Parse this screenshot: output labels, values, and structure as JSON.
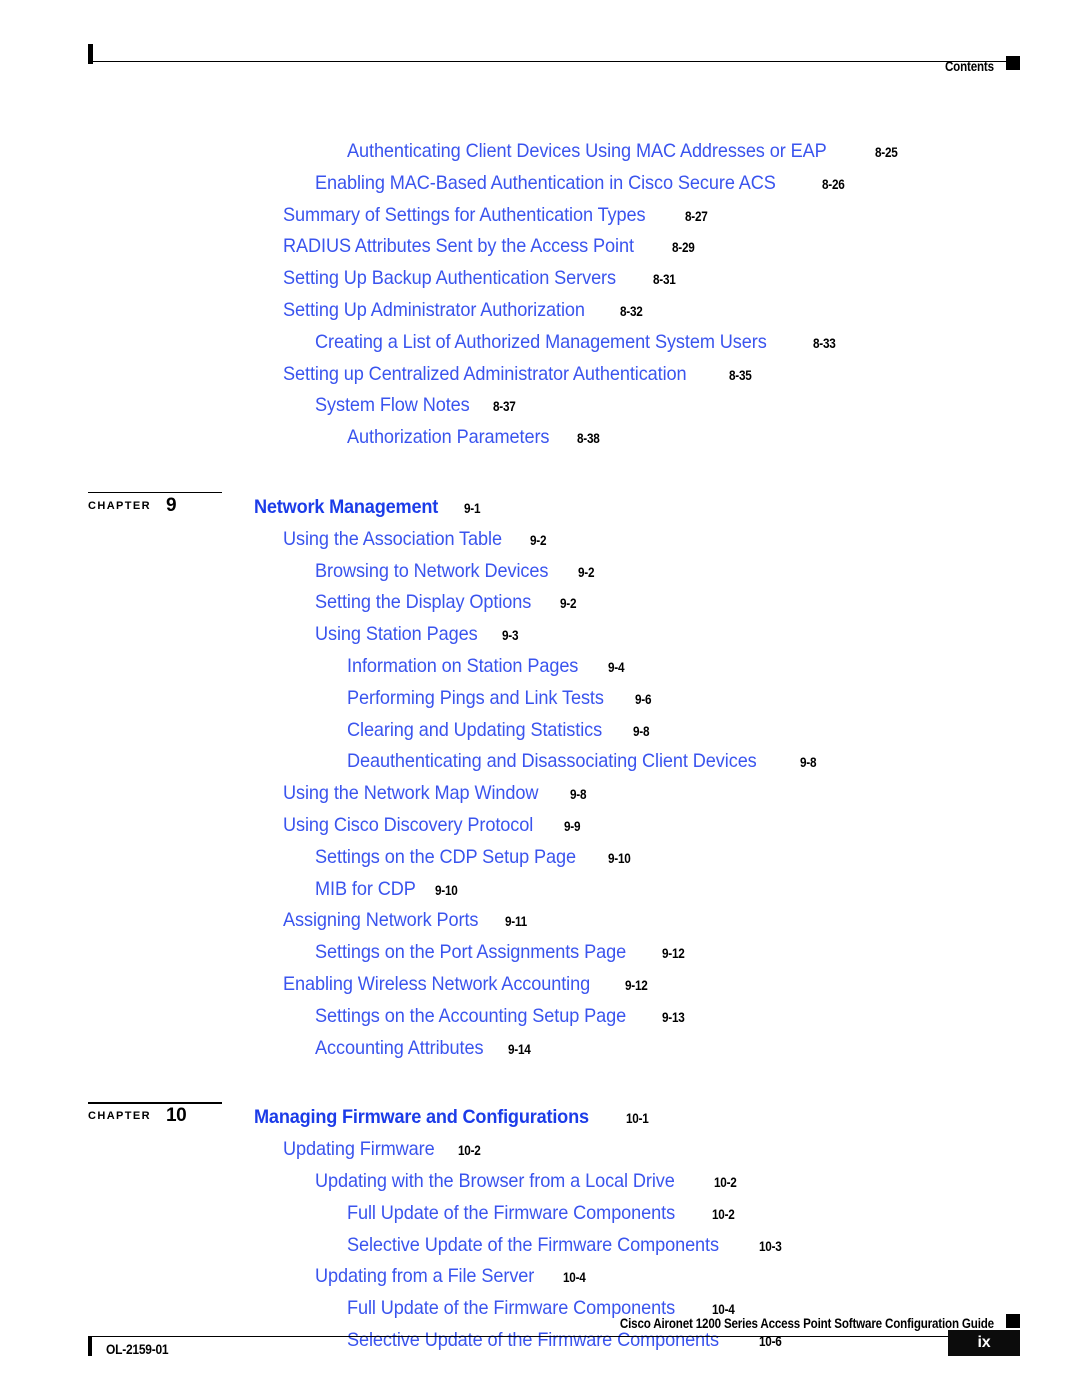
{
  "header": {
    "title": "Contents"
  },
  "footer": {
    "guide_title": "Cisco Aironet 1200 Series Access Point Software Configuration Guide",
    "doc_number": "OL-2159-01",
    "page_number": "ix"
  },
  "colors": {
    "toc_link": "#3a54ee",
    "chapter_title": "#1c3ce8",
    "page_number": "#000000",
    "rule": "#000000"
  },
  "toc": {
    "chapter_word": "CHAPTER",
    "entries": [
      {
        "kind": "entry",
        "level": 3,
        "title": "Authenticating Client Devices Using MAC Addresses or EAP",
        "page": "8-25"
      },
      {
        "kind": "entry",
        "level": 2,
        "title": "Enabling MAC-Based Authentication in Cisco Secure ACS",
        "page": "8-26"
      },
      {
        "kind": "entry",
        "level": 1,
        "title": "Summary of Settings for Authentication Types",
        "page": "8-27"
      },
      {
        "kind": "entry",
        "level": 1,
        "title": "RADIUS Attributes Sent by the Access Point",
        "page": "8-29"
      },
      {
        "kind": "entry",
        "level": 1,
        "title": "Setting Up Backup Authentication Servers",
        "page": "8-31"
      },
      {
        "kind": "entry",
        "level": 1,
        "title": "Setting Up Administrator Authorization",
        "page": "8-32"
      },
      {
        "kind": "entry",
        "level": 2,
        "title": "Creating a List of Authorized Management System Users",
        "page": "8-33"
      },
      {
        "kind": "entry",
        "level": 1,
        "title": "Setting up Centralized Administrator Authentication",
        "page": "8-35"
      },
      {
        "kind": "entry",
        "level": 2,
        "title": "System Flow Notes",
        "page": "8-37"
      },
      {
        "kind": "entry",
        "level": 3,
        "title": "Authorization Parameters",
        "page": "8-38"
      },
      {
        "kind": "spacer-lg"
      },
      {
        "kind": "chapter",
        "number": "9",
        "title": "Network Management",
        "page": "9-1"
      },
      {
        "kind": "entry",
        "level": 1,
        "title": "Using the Association Table",
        "page": "9-2"
      },
      {
        "kind": "entry",
        "level": 2,
        "title": "Browsing to Network Devices",
        "page": "9-2"
      },
      {
        "kind": "entry",
        "level": 2,
        "title": "Setting the Display Options",
        "page": "9-2"
      },
      {
        "kind": "entry",
        "level": 2,
        "title": "Using Station Pages",
        "page": "9-3"
      },
      {
        "kind": "entry",
        "level": 3,
        "title": "Information on Station Pages",
        "page": "9-4"
      },
      {
        "kind": "entry",
        "level": 3,
        "title": "Performing Pings and Link Tests",
        "page": "9-6"
      },
      {
        "kind": "entry",
        "level": 3,
        "title": "Clearing and Updating Statistics",
        "page": "9-8"
      },
      {
        "kind": "entry",
        "level": 3,
        "title": "Deauthenticating and Disassociating Client Devices",
        "page": "9-8"
      },
      {
        "kind": "entry",
        "level": 1,
        "title": "Using the Network Map Window",
        "page": "9-8"
      },
      {
        "kind": "entry",
        "level": 1,
        "title": "Using Cisco Discovery Protocol",
        "page": "9-9"
      },
      {
        "kind": "entry",
        "level": 2,
        "title": "Settings on the CDP Setup Page",
        "page": "9-10"
      },
      {
        "kind": "entry",
        "level": 2,
        "title": "MIB for CDP",
        "page": "9-10"
      },
      {
        "kind": "entry",
        "level": 1,
        "title": "Assigning Network Ports",
        "page": "9-11"
      },
      {
        "kind": "entry",
        "level": 2,
        "title": "Settings on the Port Assignments Page",
        "page": "9-12"
      },
      {
        "kind": "entry",
        "level": 1,
        "title": "Enabling Wireless Network Accounting",
        "page": "9-12"
      },
      {
        "kind": "entry",
        "level": 2,
        "title": "Settings on the Accounting Setup Page",
        "page": "9-13"
      },
      {
        "kind": "entry",
        "level": 2,
        "title": "Accounting Attributes",
        "page": "9-14"
      },
      {
        "kind": "spacer-lg"
      },
      {
        "kind": "chapter",
        "number": "10",
        "title": "Managing Firmware and Configurations",
        "page": "10-1"
      },
      {
        "kind": "entry",
        "level": 1,
        "title": "Updating Firmware",
        "page": "10-2"
      },
      {
        "kind": "entry",
        "level": 2,
        "title": "Updating with the Browser from a Local Drive",
        "page": "10-2"
      },
      {
        "kind": "entry",
        "level": 3,
        "title": "Full Update of the Firmware Components",
        "page": "10-2"
      },
      {
        "kind": "entry",
        "level": 3,
        "title": "Selective Update of the Firmware Components",
        "page": "10-3"
      },
      {
        "kind": "entry",
        "level": 2,
        "title": "Updating from a File Server",
        "page": "10-4"
      },
      {
        "kind": "entry",
        "level": 3,
        "title": "Full Update of the Firmware Components",
        "page": "10-4"
      },
      {
        "kind": "entry",
        "level": 3,
        "title": "Selective Update of the Firmware Components",
        "page": "10-6"
      }
    ]
  }
}
